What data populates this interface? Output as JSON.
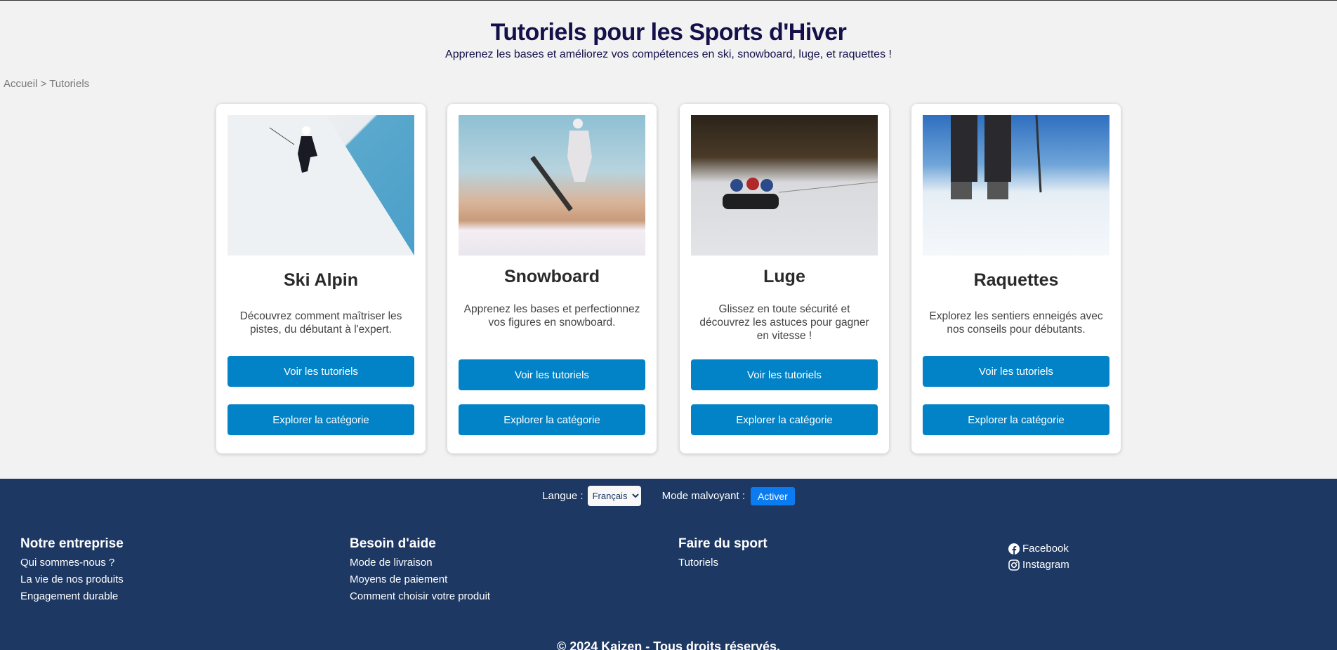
{
  "header": {
    "title": "Tutoriels pour les Sports d'Hiver",
    "subtitle": "Apprenez les bases et améliorez vos compétences en ski, snowboard, luge, et raquettes !"
  },
  "breadcrumb": {
    "home": "Accueil",
    "sep": ">",
    "current": "Tutoriels"
  },
  "cards": [
    {
      "title": "Ski Alpin",
      "description": "Découvrez comment maîtriser les pistes, du débutant à l'expert.",
      "btn1": "Voir les tutoriels",
      "btn2": "Explorer la catégorie"
    },
    {
      "title": "Snowboard",
      "description": "Apprenez les bases et perfectionnez vos figures en snowboard.",
      "btn1": "Voir les tutoriels",
      "btn2": "Explorer la catégorie"
    },
    {
      "title": "Luge",
      "description": "Glissez en toute sécurité et découvrez les astuces pour gagner en vitesse !",
      "btn1": "Voir les tutoriels",
      "btn2": "Explorer la catégorie"
    },
    {
      "title": "Raquettes",
      "description": "Explorez les sentiers enneigés avec nos conseils pour débutants.",
      "btn1": "Voir les tutoriels",
      "btn2": "Explorer la catégorie"
    }
  ],
  "footer": {
    "lang_label": "Langue :",
    "lang_value": "Français",
    "mode_label": "Mode malvoyant :",
    "mode_btn": "Activer",
    "cols": [
      {
        "title": "Notre entreprise",
        "links": [
          "Qui sommes-nous ?",
          "La vie de nos produits",
          "Engagement durable"
        ]
      },
      {
        "title": "Besoin d'aide",
        "links": [
          "Mode de livraison",
          "Moyens de paiement",
          "Comment choisir votre produit"
        ]
      },
      {
        "title": "Faire du sport",
        "links": [
          "Tutoriels"
        ]
      }
    ],
    "social": [
      "Facebook",
      "Instagram"
    ],
    "copyright": "© 2024 Kaizen - Tous droits réservés."
  },
  "colors": {
    "button": "#0283c8",
    "footer": "#1d3863",
    "title": "#14104a"
  }
}
